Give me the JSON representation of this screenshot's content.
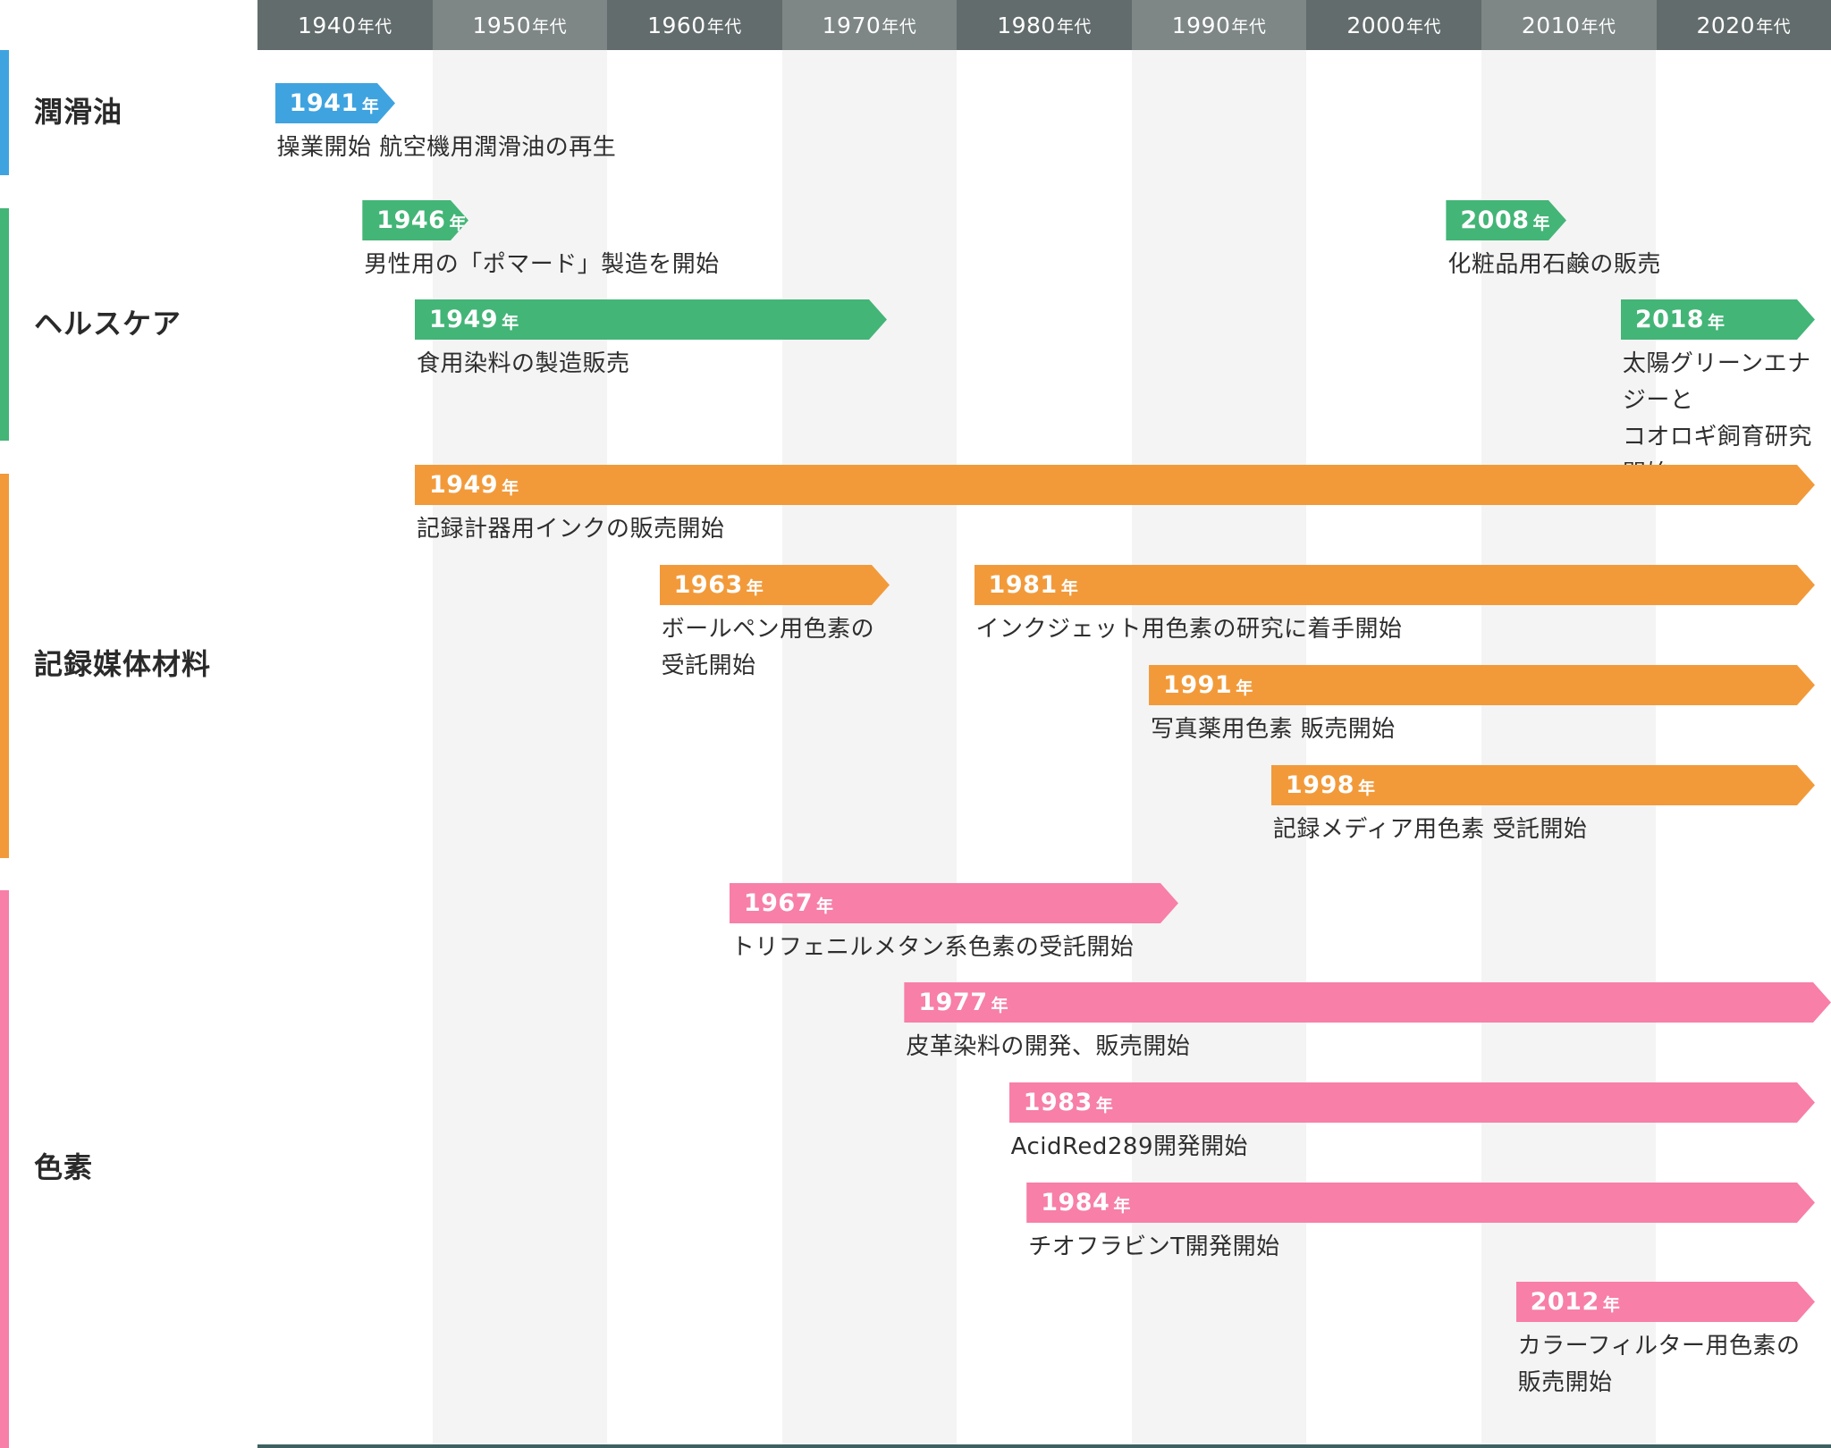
{
  "colors": {
    "header_dark": "#636c6c",
    "header_light": "#7e8686",
    "stripe_shade": "#f4f4f4",
    "lubricant": "#3fa3e0",
    "healthcare": "#43b577",
    "recording": "#f29a3a",
    "dye": "#f77fa8"
  },
  "timeline": {
    "decade_suffix": "年代",
    "year_suffix": "年",
    "decades": [
      "1940",
      "1950",
      "1960",
      "1970",
      "1980",
      "1990",
      "2000",
      "2010",
      "2020"
    ]
  },
  "categories": [
    {
      "id": "lubricant",
      "label": "潤滑油"
    },
    {
      "id": "healthcare",
      "label": "ヘルスケア"
    },
    {
      "id": "recording",
      "label": "記録媒体材料"
    },
    {
      "id": "dye",
      "label": "色素"
    }
  ],
  "events": [
    {
      "category": "lubricant",
      "year": "1941",
      "text": "操業開始  航空機用潤滑油の再生"
    },
    {
      "category": "healthcare",
      "year": "1946",
      "text": "男性用の「ポマード」製造を開始"
    },
    {
      "category": "healthcare",
      "year": "2008",
      "text": "化粧品用石鹸の販売"
    },
    {
      "category": "healthcare",
      "year": "1949",
      "text": "食用染料の製造販売"
    },
    {
      "category": "healthcare",
      "year": "2018",
      "text": "太陽グリーンエナジーと\nコオロギ飼育研究開始"
    },
    {
      "category": "recording",
      "year": "1949",
      "text": "記録計器用インクの販売開始"
    },
    {
      "category": "recording",
      "year": "1963",
      "text": "ボールペン用色素の\n受託開始"
    },
    {
      "category": "recording",
      "year": "1981",
      "text": "インクジェット用色素の研究に着手開始"
    },
    {
      "category": "recording",
      "year": "1991",
      "text": "写真薬用色素  販売開始"
    },
    {
      "category": "recording",
      "year": "1998",
      "text": "記録メディア用色素  受託開始"
    },
    {
      "category": "dye",
      "year": "1967",
      "text": "トリフェニルメタン系色素の受託開始"
    },
    {
      "category": "dye",
      "year": "1977",
      "text": "皮革染料の開発、販売開始"
    },
    {
      "category": "dye",
      "year": "1983",
      "text": "AcidRed289開発開始"
    },
    {
      "category": "dye",
      "year": "1984",
      "text": "チオフラビンT開発開始"
    },
    {
      "category": "dye",
      "year": "2012",
      "text": "カラーフィルター用色素の\n販売開始"
    }
  ]
}
